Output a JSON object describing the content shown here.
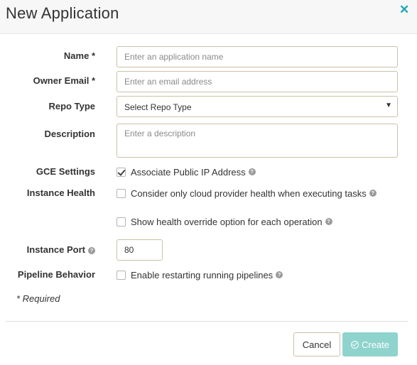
{
  "dialog": {
    "title": "New Application",
    "close_icon": "close-icon"
  },
  "form": {
    "name": {
      "label": "Name *",
      "value": "",
      "placeholder": "Enter an application name"
    },
    "owner_email": {
      "label": "Owner Email *",
      "value": "",
      "placeholder": "Enter an email address"
    },
    "repo_type": {
      "label": "Repo Type",
      "selected": "Select Repo Type"
    },
    "description": {
      "label": "Description",
      "value": "",
      "placeholder": "Enter a description"
    },
    "gce_settings": {
      "label": "GCE Settings",
      "option": "Associate Public IP Address",
      "checked": true
    },
    "instance_health": {
      "label": "Instance Health",
      "options": [
        {
          "text": "Consider only cloud provider health when executing tasks",
          "checked": false
        },
        {
          "text": "Show health override option for each operation",
          "checked": false
        }
      ]
    },
    "instance_port": {
      "label": "Instance Port",
      "value": "80"
    },
    "pipeline_behavior": {
      "label": "Pipeline Behavior",
      "option": "Enable restarting running pipelines",
      "checked": false
    },
    "required_note": "* Required"
  },
  "footer": {
    "cancel_label": "Cancel",
    "create_label": "Create"
  },
  "colors": {
    "accent": "#1aa6b7",
    "create_button": "#8fd3cd",
    "header_bg": "#f7f7f7",
    "input_border": "#c8c2a8"
  }
}
